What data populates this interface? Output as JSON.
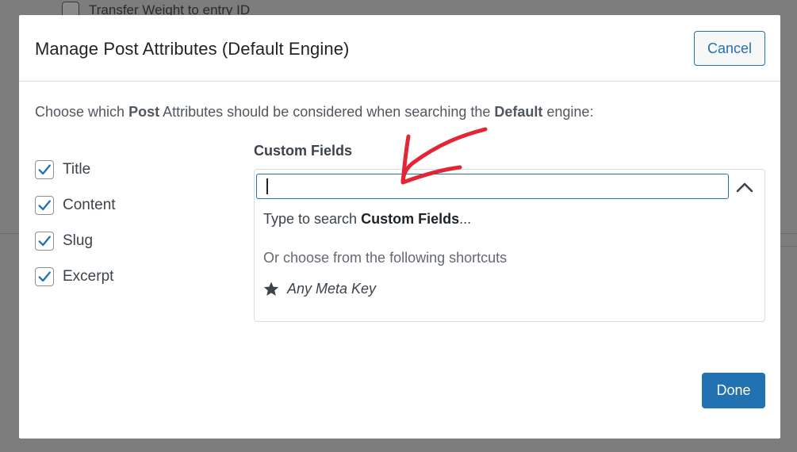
{
  "background": {
    "partial_row_label": "Transfer Weight to entry ID"
  },
  "modal": {
    "title": "Manage Post Attributes (Default Engine)",
    "cancel_label": "Cancel",
    "intro": {
      "prefix": "Choose which ",
      "bold1": "Post",
      "middle": " Attributes should be considered when searching the ",
      "bold2": "Default",
      "suffix": " engine:"
    },
    "attributes": [
      {
        "label": "Title",
        "checked": true
      },
      {
        "label": "Content",
        "checked": true
      },
      {
        "label": "Slug",
        "checked": true
      },
      {
        "label": "Excerpt",
        "checked": true
      }
    ],
    "custom_fields": {
      "label": "Custom Fields",
      "input_value": "",
      "hint_prefix": "Type to search ",
      "hint_bold": "Custom Fields",
      "hint_suffix": "...",
      "shortcuts_label": "Or choose from the following shortcuts",
      "shortcuts": [
        {
          "label": "Any Meta Key",
          "icon": "star-icon"
        }
      ]
    },
    "done_label": "Done"
  },
  "colors": {
    "accent": "#2271b1",
    "annotation": "#e32636",
    "overlay": "#6e6e6e"
  }
}
